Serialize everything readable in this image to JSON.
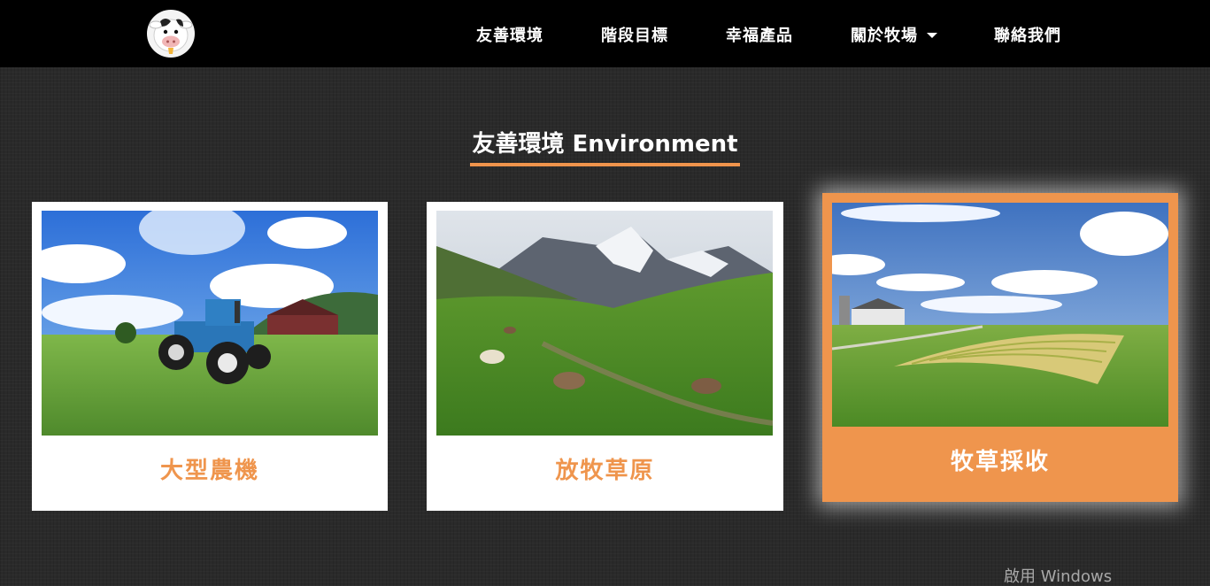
{
  "header": {
    "logo_icon": "cow-mascot-icon",
    "nav": [
      {
        "label": "友善環境"
      },
      {
        "label": "階段目標"
      },
      {
        "label": "幸福產品"
      },
      {
        "label": "關於牧場",
        "has_dropdown": true
      },
      {
        "label": "聯絡我們"
      }
    ]
  },
  "section": {
    "title": "友善環境 Environment",
    "accent_color": "#f0944c"
  },
  "cards": [
    {
      "caption": "大型農機",
      "image": "tractor-on-grass-photo",
      "active": false
    },
    {
      "caption": "放牧草原",
      "image": "cows-grazing-alpine-meadow-photo",
      "active": false
    },
    {
      "caption": "牧草採收",
      "image": "farm-field-harvest-photo",
      "active": true
    }
  ],
  "watermark": {
    "text": "啟用 Windows"
  }
}
